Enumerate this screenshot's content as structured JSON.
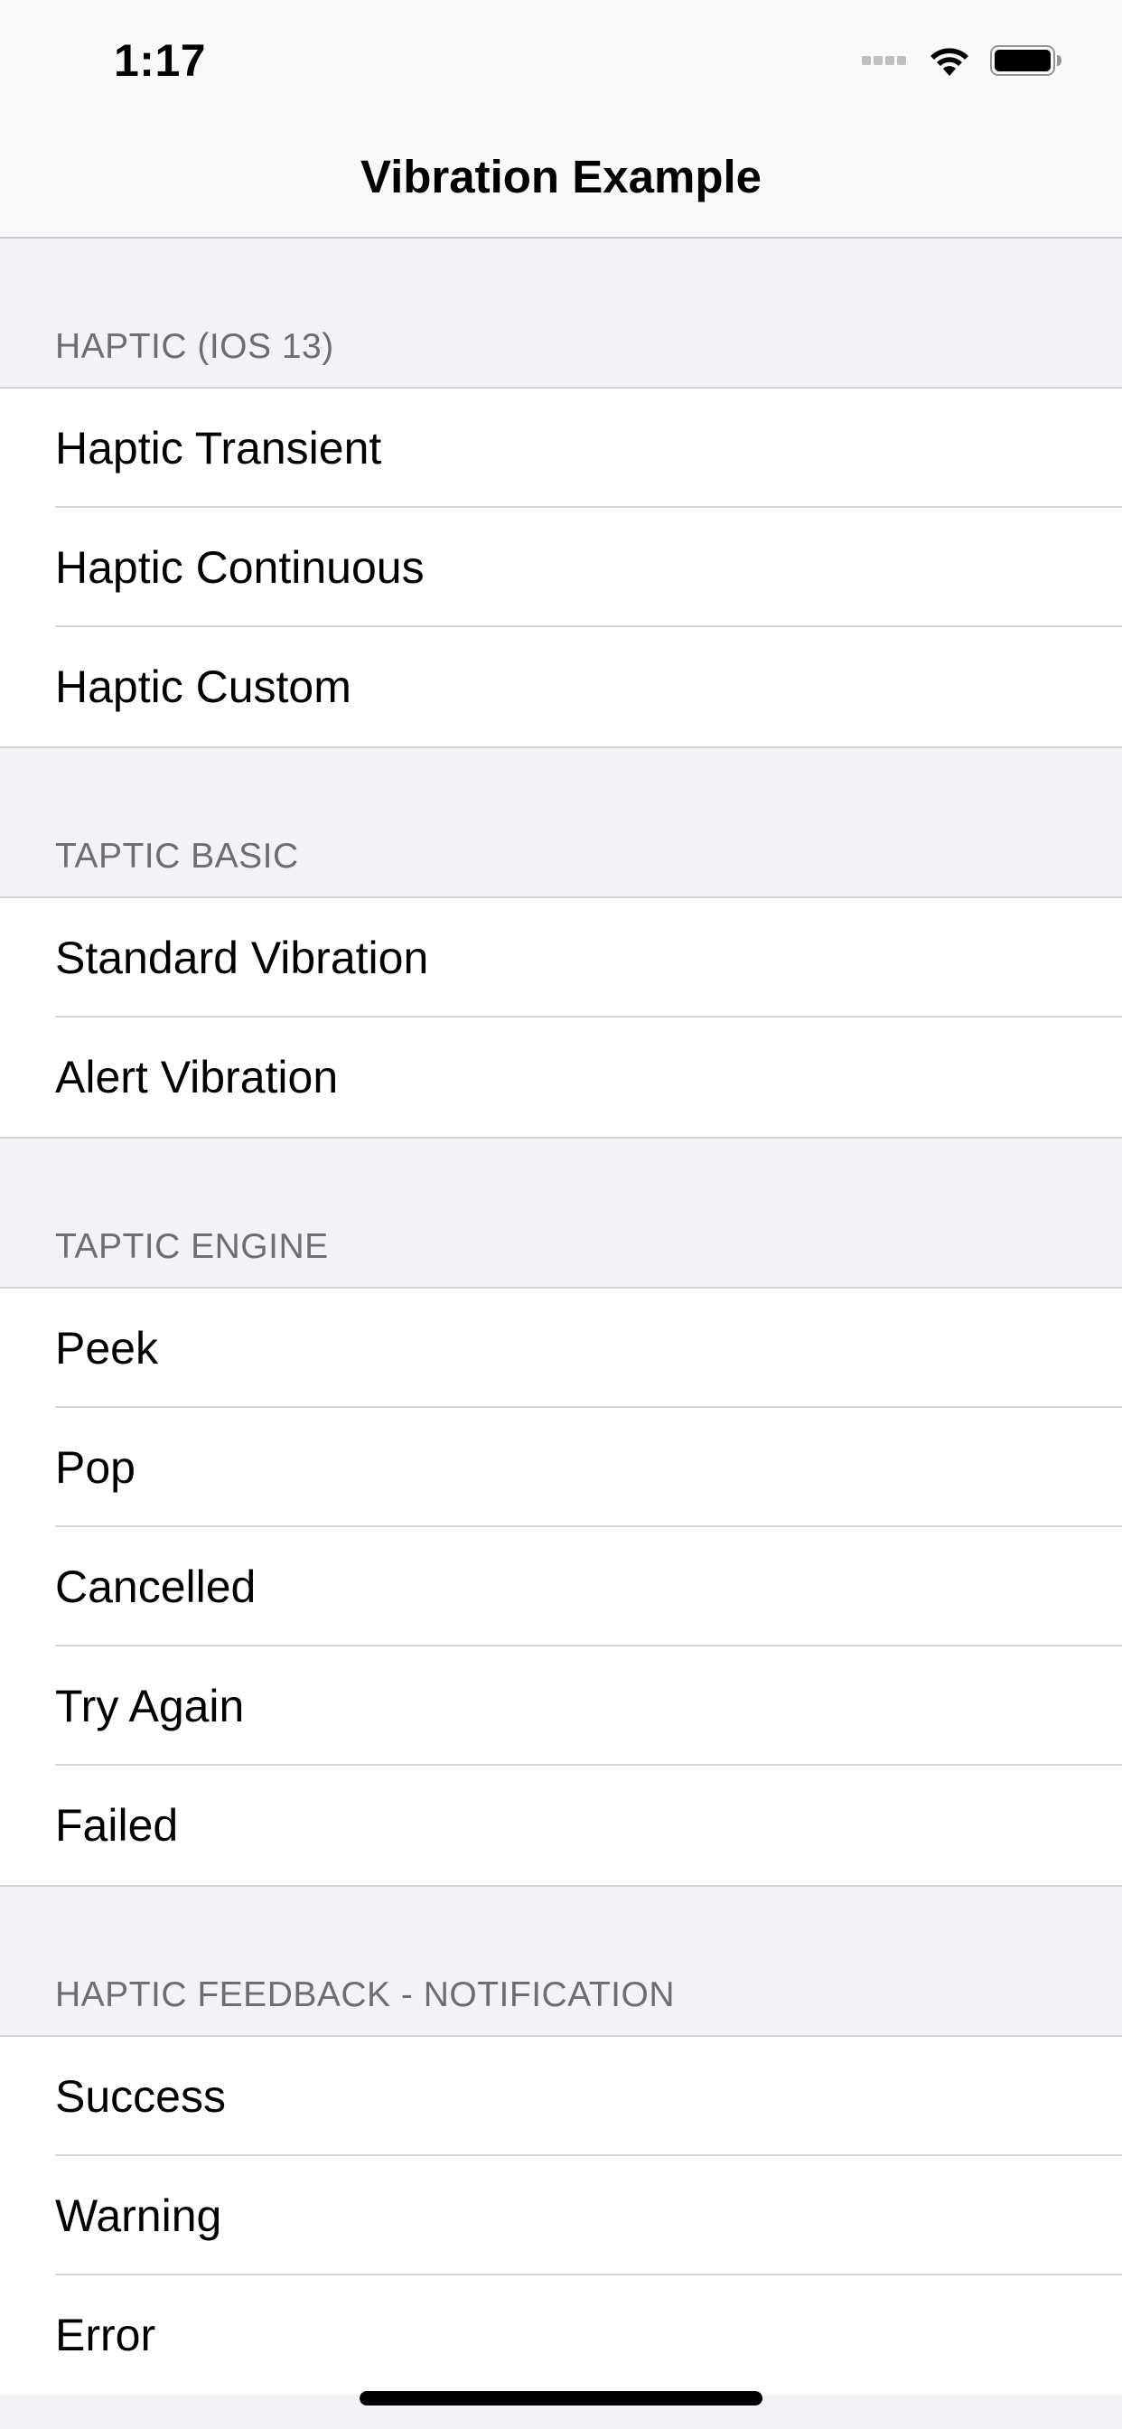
{
  "status_bar": {
    "time": "1:17"
  },
  "nav": {
    "title": "Vibration Example"
  },
  "sections": [
    {
      "header": "HAPTIC (IOS 13)",
      "items": [
        "Haptic Transient",
        "Haptic Continuous",
        "Haptic Custom"
      ]
    },
    {
      "header": "TAPTIC BASIC",
      "items": [
        "Standard Vibration",
        "Alert Vibration"
      ]
    },
    {
      "header": "TAPTIC ENGINE",
      "items": [
        "Peek",
        "Pop",
        "Cancelled",
        "Try Again",
        "Failed"
      ]
    },
    {
      "header": "HAPTIC FEEDBACK - NOTIFICATION",
      "items": [
        "Success",
        "Warning",
        "Error"
      ]
    }
  ],
  "colors": {
    "background": "#f2f2f7",
    "header_text": "#6d6d72",
    "separator": "#d8d8dc"
  }
}
